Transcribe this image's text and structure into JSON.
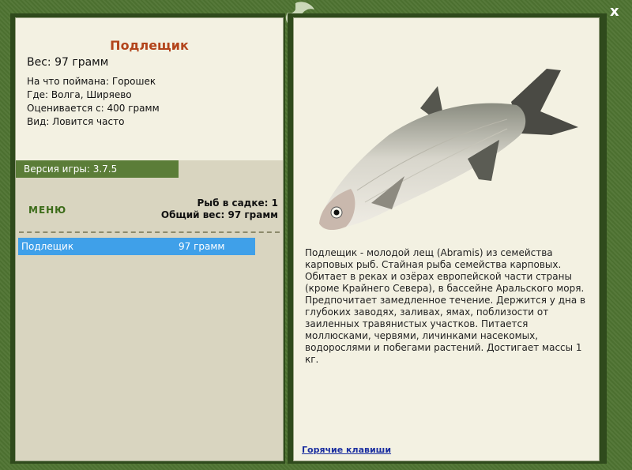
{
  "fish": {
    "title": "Подлещик",
    "weight": "Вес: 97 грамм",
    "bait": "На что поймана: Горошек",
    "location": "Где: Волга, Ширяево",
    "value": "Оценивается с: 400 грамм",
    "frequency": "Вид: Ловится часто"
  },
  "version": "Версия игры: 3.7.5",
  "menu": {
    "label": "МЕНЮ"
  },
  "stats": {
    "count": "Рыб в садке: 1",
    "total": "Общий вес: 97 грамм"
  },
  "catch_list": [
    {
      "name": "Подлещик",
      "weight": "97 грамм"
    }
  ],
  "description": "Подлещик - молодой лещ (Abramis) из семейства карповых рыб. Стайная рыба семейства карповых. Обитает в реках и озёрах европейской части страны (кроме Крайнего Севера), в бассейне Аральского моря. Предпочитает замедленное течение. Держится у дна в глубоких заводях, заливах, ямах, поблизости от заиленных травянистых участков. Питается моллюсками, червями, личинками насекомых, водорослями и побегами растений. Достигает массы 1 кг.",
  "hotkeys": {
    "label": "Горячие клавиши"
  },
  "close": {
    "icon": "close-icon",
    "glyph": "x"
  },
  "colors": {
    "frame": "#4f7432",
    "panel": "#f3f1e2",
    "accent_title": "#b3441b",
    "selection": "#3fa0e9",
    "version_bar": "#5b7d38"
  }
}
